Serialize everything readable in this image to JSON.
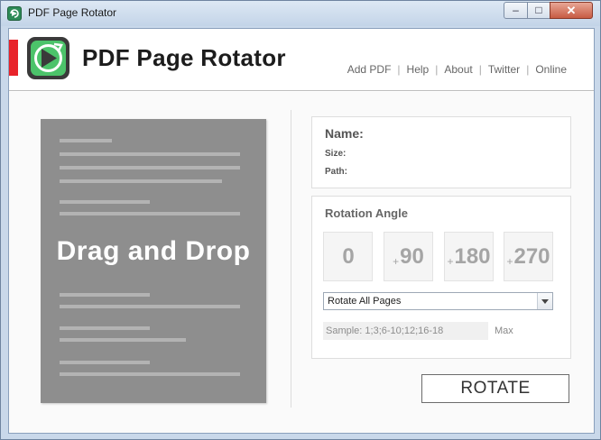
{
  "window": {
    "title": "PDF Page Rotator",
    "controls": {
      "minimize": "–",
      "maximize": "□",
      "close": "✕"
    }
  },
  "header": {
    "app_name": "PDF Page Rotator",
    "nav": [
      {
        "label": "Add PDF"
      },
      {
        "label": "Help"
      },
      {
        "label": "About"
      },
      {
        "label": "Twitter"
      },
      {
        "label": "Online"
      }
    ],
    "separator": "|"
  },
  "drop_zone": {
    "label": "Drag and Drop"
  },
  "file_info": {
    "name_label": "Name:",
    "size_label": "Size:",
    "path_label": "Path:"
  },
  "rotation": {
    "title": "Rotation Angle",
    "angles": [
      {
        "prefix": "",
        "value": "0"
      },
      {
        "prefix": "+",
        "value": "90"
      },
      {
        "prefix": "+",
        "value": "180"
      },
      {
        "prefix": "+",
        "value": "270"
      }
    ],
    "mode_selected": "Rotate All Pages",
    "pages_placeholder": "Sample: 1;3;6-10;12;16-18",
    "max_label": "Max"
  },
  "actions": {
    "rotate_label": "ROTATE"
  },
  "colors": {
    "accent_red": "#e8232a",
    "drop_zone_bg": "#8e8e8e",
    "logo_green": "#4cc36a"
  }
}
